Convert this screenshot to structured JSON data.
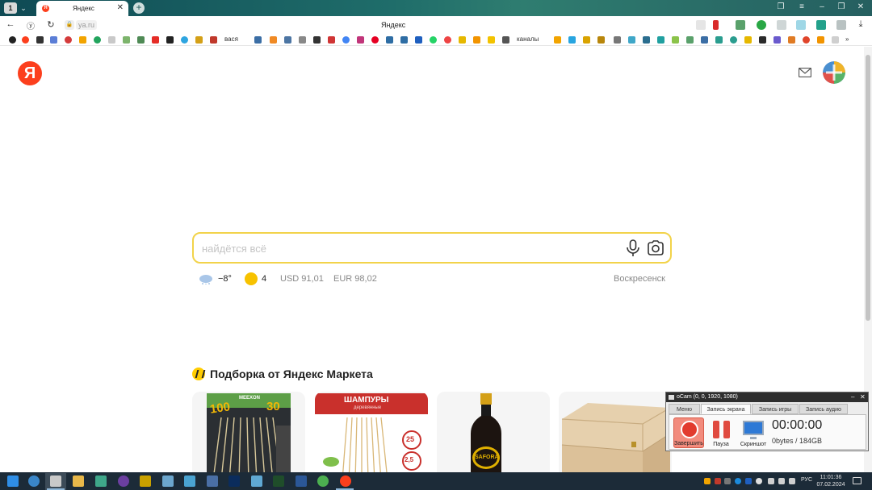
{
  "browser": {
    "tab_count": "1",
    "tab_title": "Яндекс",
    "address": "ya.ru",
    "page_caption": "Яндекс",
    "bookmarks_text": [
      "вася",
      "каналы"
    ]
  },
  "page": {
    "logo_letter": "Я",
    "search": {
      "placeholder": "найдётся всё",
      "value": ""
    },
    "informers": {
      "temperature": "−8°",
      "traffic_score": "4",
      "usd": "USD 91,01",
      "eur": "EUR 98,02",
      "city": "Воскресенск"
    },
    "market": {
      "title": "Подборка от Яндекс Маркета",
      "cards": [
        {
          "name": "sticks",
          "label_top": "MEEXON",
          "label_num": "100",
          "label_num2": "30"
        },
        {
          "name": "skewers",
          "label_top": "ШАМПУРЫ",
          "label_sub": "деревянные",
          "badge1": "25",
          "badge2": "2,5"
        },
        {
          "name": "sauce",
          "label": "SAFORA"
        },
        {
          "name": "wooden-box"
        }
      ]
    }
  },
  "ocam": {
    "title": "oCam (0, 0, 1920, 1080)",
    "tabs": [
      "Меню",
      "Запись экрана",
      "Запись игры",
      "Запись аудио"
    ],
    "active_tab": "Запись экрана",
    "buttons": {
      "stop": "Завершить",
      "pause": "Пауза",
      "screenshot": "Скриншот"
    },
    "timer": "00:00:00",
    "size": "0bytes / 184GB"
  },
  "taskbar": {
    "language": "РУС",
    "time": "11:01:36",
    "date": "07.02.2024"
  },
  "colors": {
    "yandex_red": "#fc3f1d",
    "search_border": "#f2d34a",
    "browser_tabbar": "#1f6d6a",
    "taskbar": "#1c2b38"
  }
}
